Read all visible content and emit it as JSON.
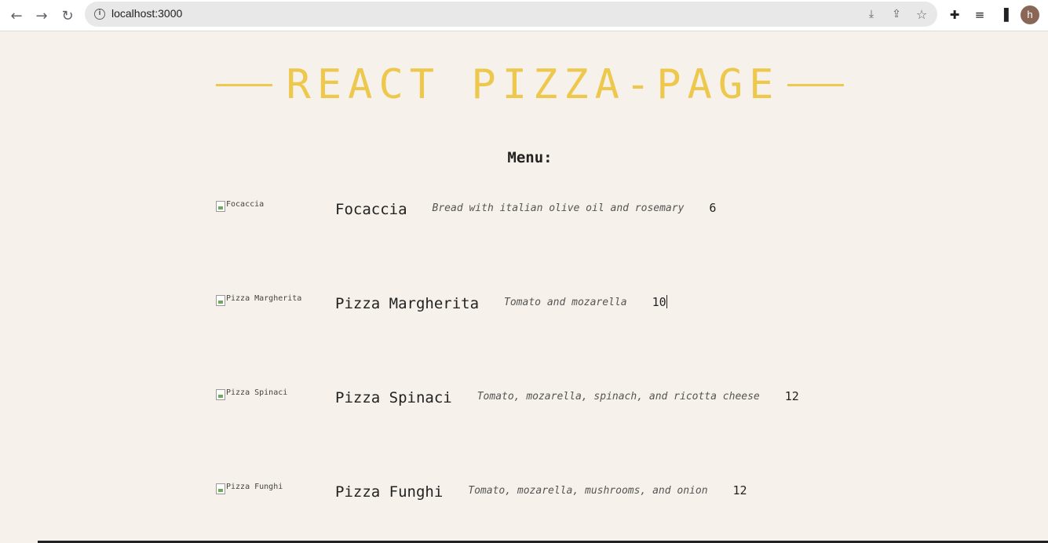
{
  "browser": {
    "url": "localhost:3000",
    "profile_initial": "h"
  },
  "page": {
    "title": "REACT PIZZA-PAGE",
    "menu_heading": "Menu:"
  },
  "menu": [
    {
      "image_alt": "Focaccia",
      "name": "Focaccia",
      "description": "Bread with italian olive oil and rosemary",
      "price": "6"
    },
    {
      "image_alt": "Pizza Margherita",
      "name": "Pizza Margherita",
      "description": "Tomato and mozarella",
      "price": "10"
    },
    {
      "image_alt": "Pizza Spinaci",
      "name": "Pizza Spinaci",
      "description": "Tomato, mozarella, spinach, and ricotta cheese",
      "price": "12"
    },
    {
      "image_alt": "Pizza Funghi",
      "name": "Pizza Funghi",
      "description": "Tomato, mozarella, mushrooms, and onion",
      "price": "12"
    }
  ],
  "colors": {
    "accent": "#edc84c",
    "background": "#f6f1ea"
  }
}
